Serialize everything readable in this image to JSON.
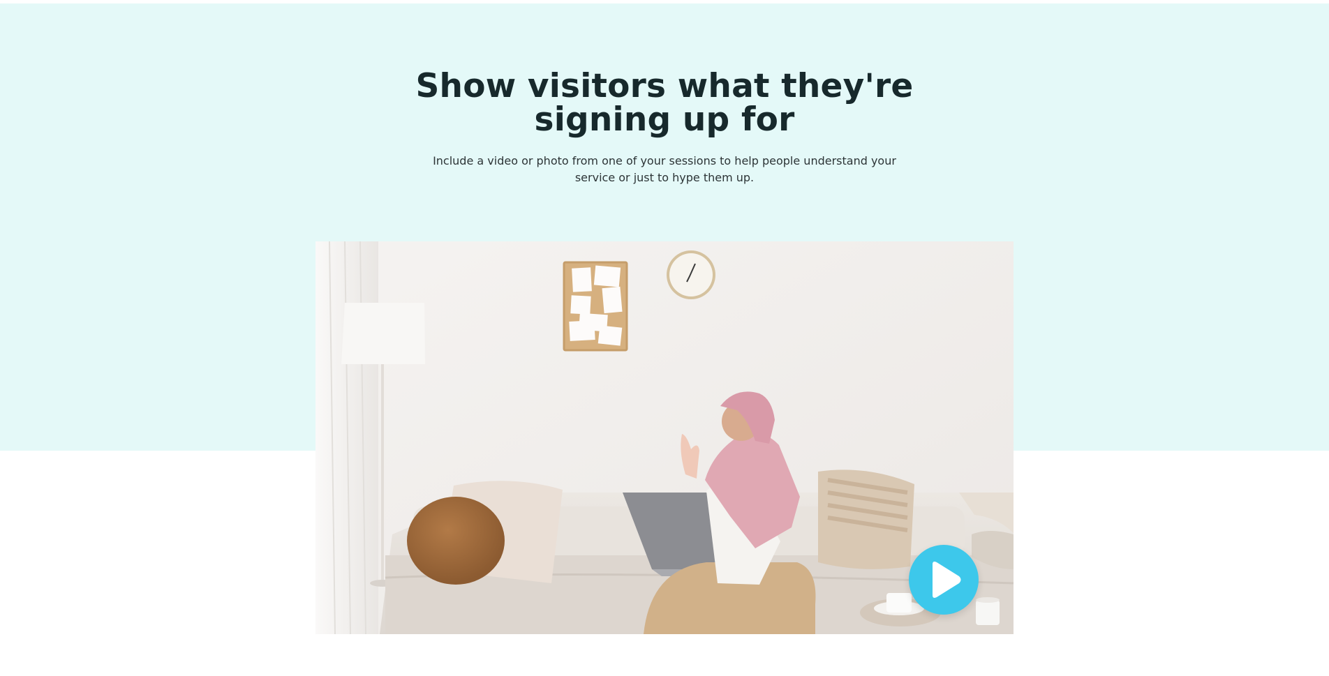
{
  "hero": {
    "title": "Show visitors what they're signing up for",
    "subtitle": "Include a video or photo from one of your sessions to help people understand your service or just to hype them up."
  },
  "media": {
    "type": "video-thumbnail",
    "play_icon": "play-icon"
  },
  "colors": {
    "band_background": "#e4f9f8",
    "title_text": "#17292c",
    "body_text": "#2c3436",
    "play_button": "#3dc8eb"
  }
}
